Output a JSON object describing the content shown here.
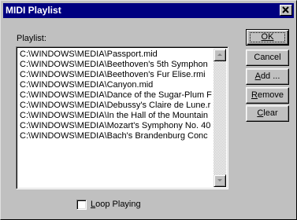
{
  "window": {
    "title": "MIDI Playlist"
  },
  "playlist": {
    "label": "Playlist:",
    "items": [
      "C:\\WINDOWS\\MEDIA\\Passport.mid",
      "C:\\WINDOWS\\MEDIA\\Beethoven's 5th Symphon",
      "C:\\WINDOWS\\MEDIA\\Beethoven's Fur Elise.rmi",
      "C:\\WINDOWS\\MEDIA\\Canyon.mid",
      "C:\\WINDOWS\\MEDIA\\Dance of the Sugar-Plum F",
      "C:\\WINDOWS\\MEDIA\\Debussy's Claire de Lune.r",
      "C:\\WINDOWS\\MEDIA\\In the Hall of the Mountain",
      "C:\\WINDOWS\\MEDIA\\Mozart's Symphony No. 40",
      "C:\\WINDOWS\\MEDIA\\Bach's Brandenburg Conc"
    ]
  },
  "buttons": {
    "ok": "OK",
    "cancel": "Cancel",
    "add_prefix": "A",
    "add_rest": "dd ...",
    "remove_prefix": "R",
    "remove_rest": "emove",
    "clear_prefix": "C",
    "clear_rest": "lear"
  },
  "options": {
    "loop_prefix": "L",
    "loop_rest": "oop Playing",
    "loop_checked": false
  },
  "icons": {
    "close": "close-icon",
    "scroll_up": "arrow-up-icon",
    "scroll_down": "arrow-down-icon"
  }
}
